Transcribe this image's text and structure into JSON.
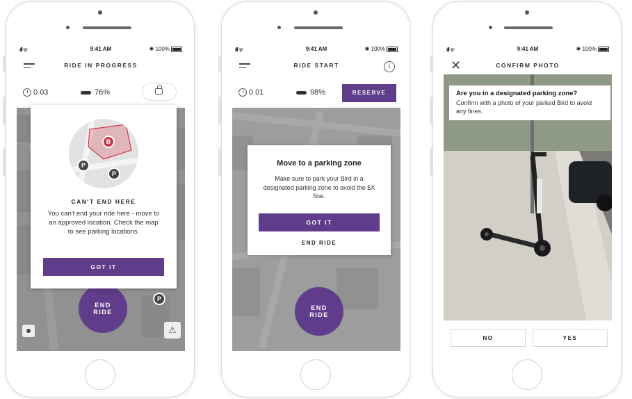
{
  "screens": [
    {
      "status": {
        "signal": "ıll ᯤ",
        "time": "9:41 AM",
        "battery": "✱ 100%"
      },
      "header": {
        "title": "RIDE IN PROGRESS"
      },
      "stats": {
        "distance": "0.03",
        "battery": "76%"
      },
      "modal": {
        "title": "CAN'T END HERE",
        "body": "You can't end your ride here - move to an approved location. Check the map to see parking locations.",
        "primary": "GOT IT",
        "map_pins": [
          "P",
          "P"
        ],
        "zone_pin": "B"
      },
      "end_ride": {
        "line1": "END",
        "line2": "RIDE"
      },
      "map_pin": "P"
    },
    {
      "status": {
        "signal": "ıll ᯤ",
        "time": "9:41 AM",
        "battery": "✱ 100%"
      },
      "header": {
        "title": "RIDE START",
        "info": "i"
      },
      "stats": {
        "distance": "0.01",
        "battery": "98%",
        "reserve": "RESERVE"
      },
      "modal": {
        "title": "Move to a parking zone",
        "body": "Make sure to park your Bird in a designated parking zone to avoid the $X fine.",
        "primary": "GOT IT",
        "secondary": "END RIDE"
      },
      "end_ride": {
        "line1": "END",
        "line2": "RIDE"
      }
    },
    {
      "status": {
        "signal": "ıll ᯤ",
        "time": "9:41 AM",
        "battery": "✱ 100%"
      },
      "header": {
        "title": "CONFIRM PHOTO",
        "close": "✕"
      },
      "tip": {
        "question": "Are you in a designated parking zone?",
        "detail": "Confirm with a photo of your parked Bird to avoid any fines."
      },
      "buttons": {
        "no": "NO",
        "yes": "YES"
      }
    }
  ],
  "colors": {
    "accent": "#5f3d8a",
    "zone_red": "#d3344a"
  }
}
